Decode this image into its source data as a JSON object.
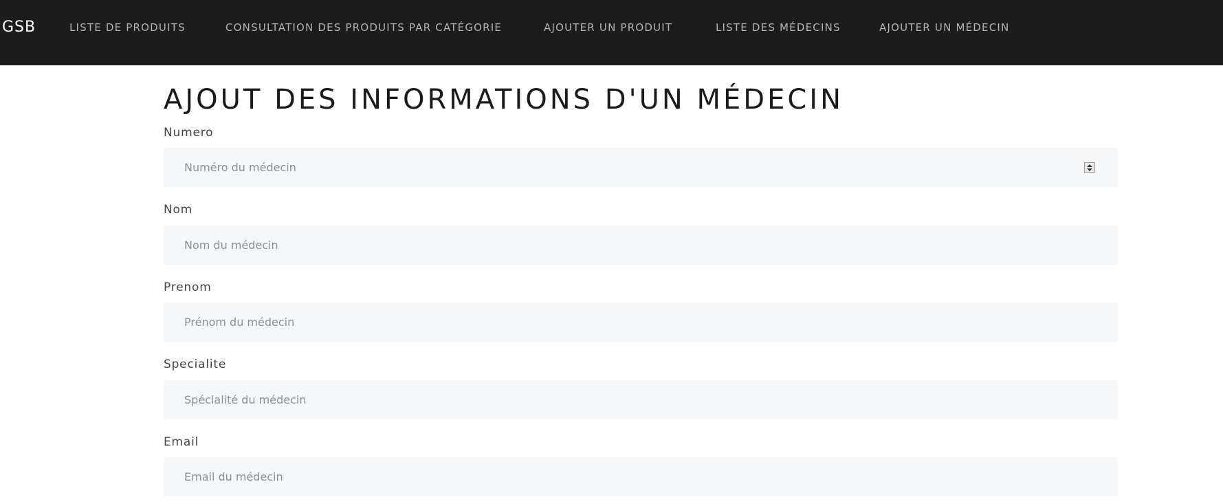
{
  "navbar": {
    "brand": "GSB",
    "links": [
      {
        "label": "LISTE DE PRODUITS"
      },
      {
        "label": "CONSULTATION DES PRODUITS PAR CATÉGORIE"
      },
      {
        "label": "AJOUTER UN PRODUIT"
      },
      {
        "label": "LISTE DES MÉDECINS"
      },
      {
        "label": "AJOUTER UN MÉDECIN"
      }
    ]
  },
  "main": {
    "title": "AJOUT DES INFORMATIONS D'UN MÉDECIN",
    "fields": [
      {
        "label": "Numero",
        "placeholder": "Numéro du médecin",
        "value": ""
      },
      {
        "label": "Nom",
        "placeholder": "Nom du médecin",
        "value": ""
      },
      {
        "label": "Prenom",
        "placeholder": "Prénom du médecin",
        "value": ""
      },
      {
        "label": "Specialite",
        "placeholder": "Spécialité du médecin",
        "value": ""
      },
      {
        "label": "Email",
        "placeholder": "Email du médecin",
        "value": ""
      }
    ]
  },
  "colors": {
    "navbar_bg": "#1c1c1c",
    "input_bg": "#f6f7f9"
  }
}
